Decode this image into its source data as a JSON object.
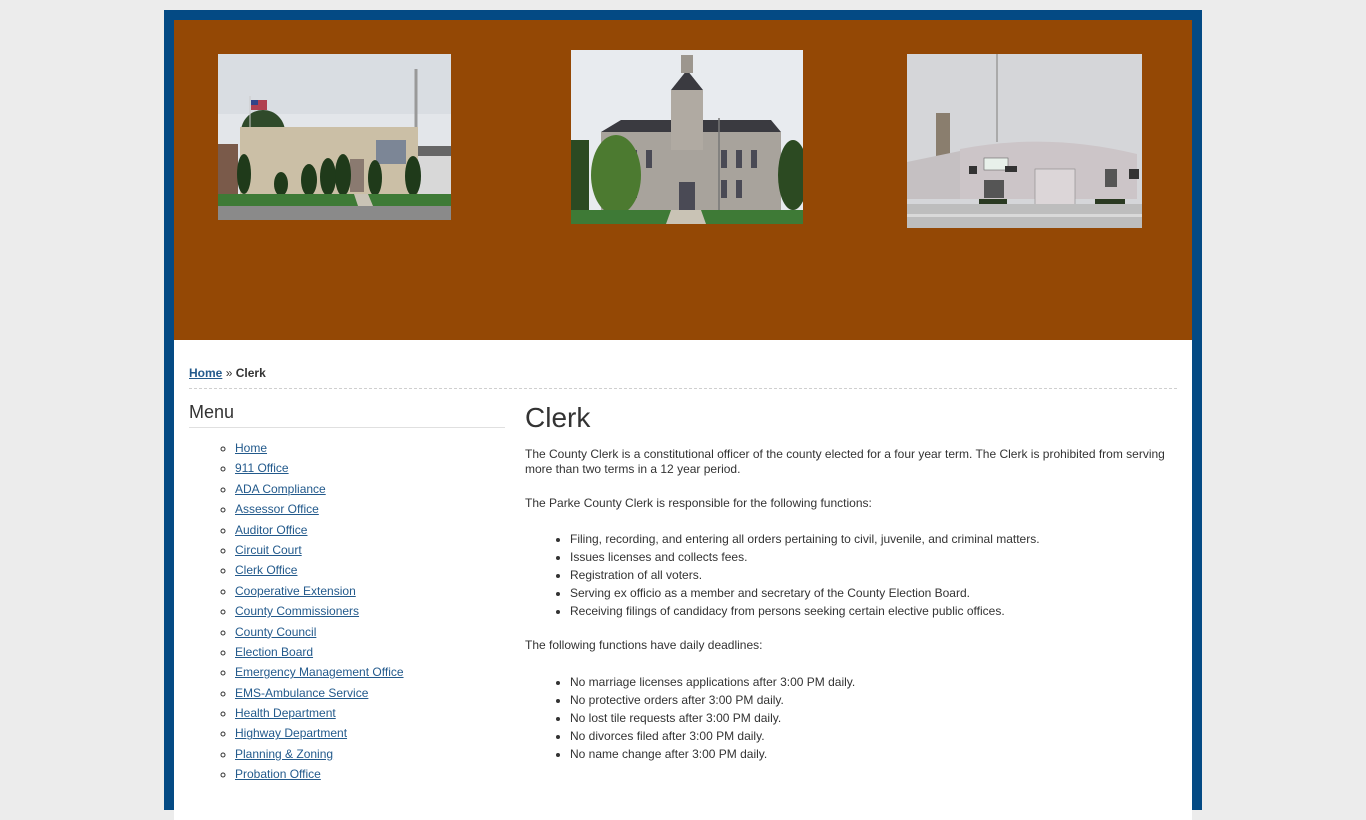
{
  "header": {
    "photos": [
      {
        "alt": "Parke County Emergency Management building"
      },
      {
        "alt": "Parke County Courthouse"
      },
      {
        "alt": "County highway department building"
      }
    ]
  },
  "breadcrumb": {
    "home": "Home",
    "separator": "»",
    "current": "Clerk"
  },
  "sidebar": {
    "title": "Menu",
    "items": [
      {
        "label": "Home"
      },
      {
        "label": "911 Office"
      },
      {
        "label": "ADA Compliance"
      },
      {
        "label": "Assessor Office"
      },
      {
        "label": "Auditor Office"
      },
      {
        "label": "Circuit Court"
      },
      {
        "label": "Clerk Office"
      },
      {
        "label": "Cooperative Extension"
      },
      {
        "label": "County Commissioners"
      },
      {
        "label": "County Council"
      },
      {
        "label": "Election Board"
      },
      {
        "label": "Emergency Management Office"
      },
      {
        "label": "EMS-Ambulance Service"
      },
      {
        "label": "Health Department"
      },
      {
        "label": "Highway Department"
      },
      {
        "label": "Planning & Zoning"
      },
      {
        "label": "Probation Office"
      }
    ]
  },
  "main": {
    "title": "Clerk",
    "intro": "The County Clerk is a constitutional officer of the county elected for a four year term. The Clerk is prohibited from serving more than two terms in a 12 year period.",
    "functions_intro": "The Parke County Clerk is responsible for the following functions:",
    "functions": [
      "Filing, recording, and entering all orders pertaining to civil, juvenile, and criminal matters.",
      "Issues licenses and collects fees.",
      "Registration of all voters.",
      "Serving ex officio as a member and secretary of the County Election Board.",
      "Receiving filings of candidacy from persons seeking certain elective public offices."
    ],
    "deadlines_intro": "The following functions have daily deadlines:",
    "deadlines": [
      "No marriage licenses applications after 3:00 PM daily.",
      "No protective orders after 3:00 PM daily.",
      "No lost tile requests after 3:00 PM daily.",
      "No divorces filed after 3:00 PM daily.",
      "No name change after 3:00 PM daily."
    ]
  },
  "colors": {
    "frame": "#044a84",
    "header_bg": "#944805",
    "link": "#235a8c"
  }
}
